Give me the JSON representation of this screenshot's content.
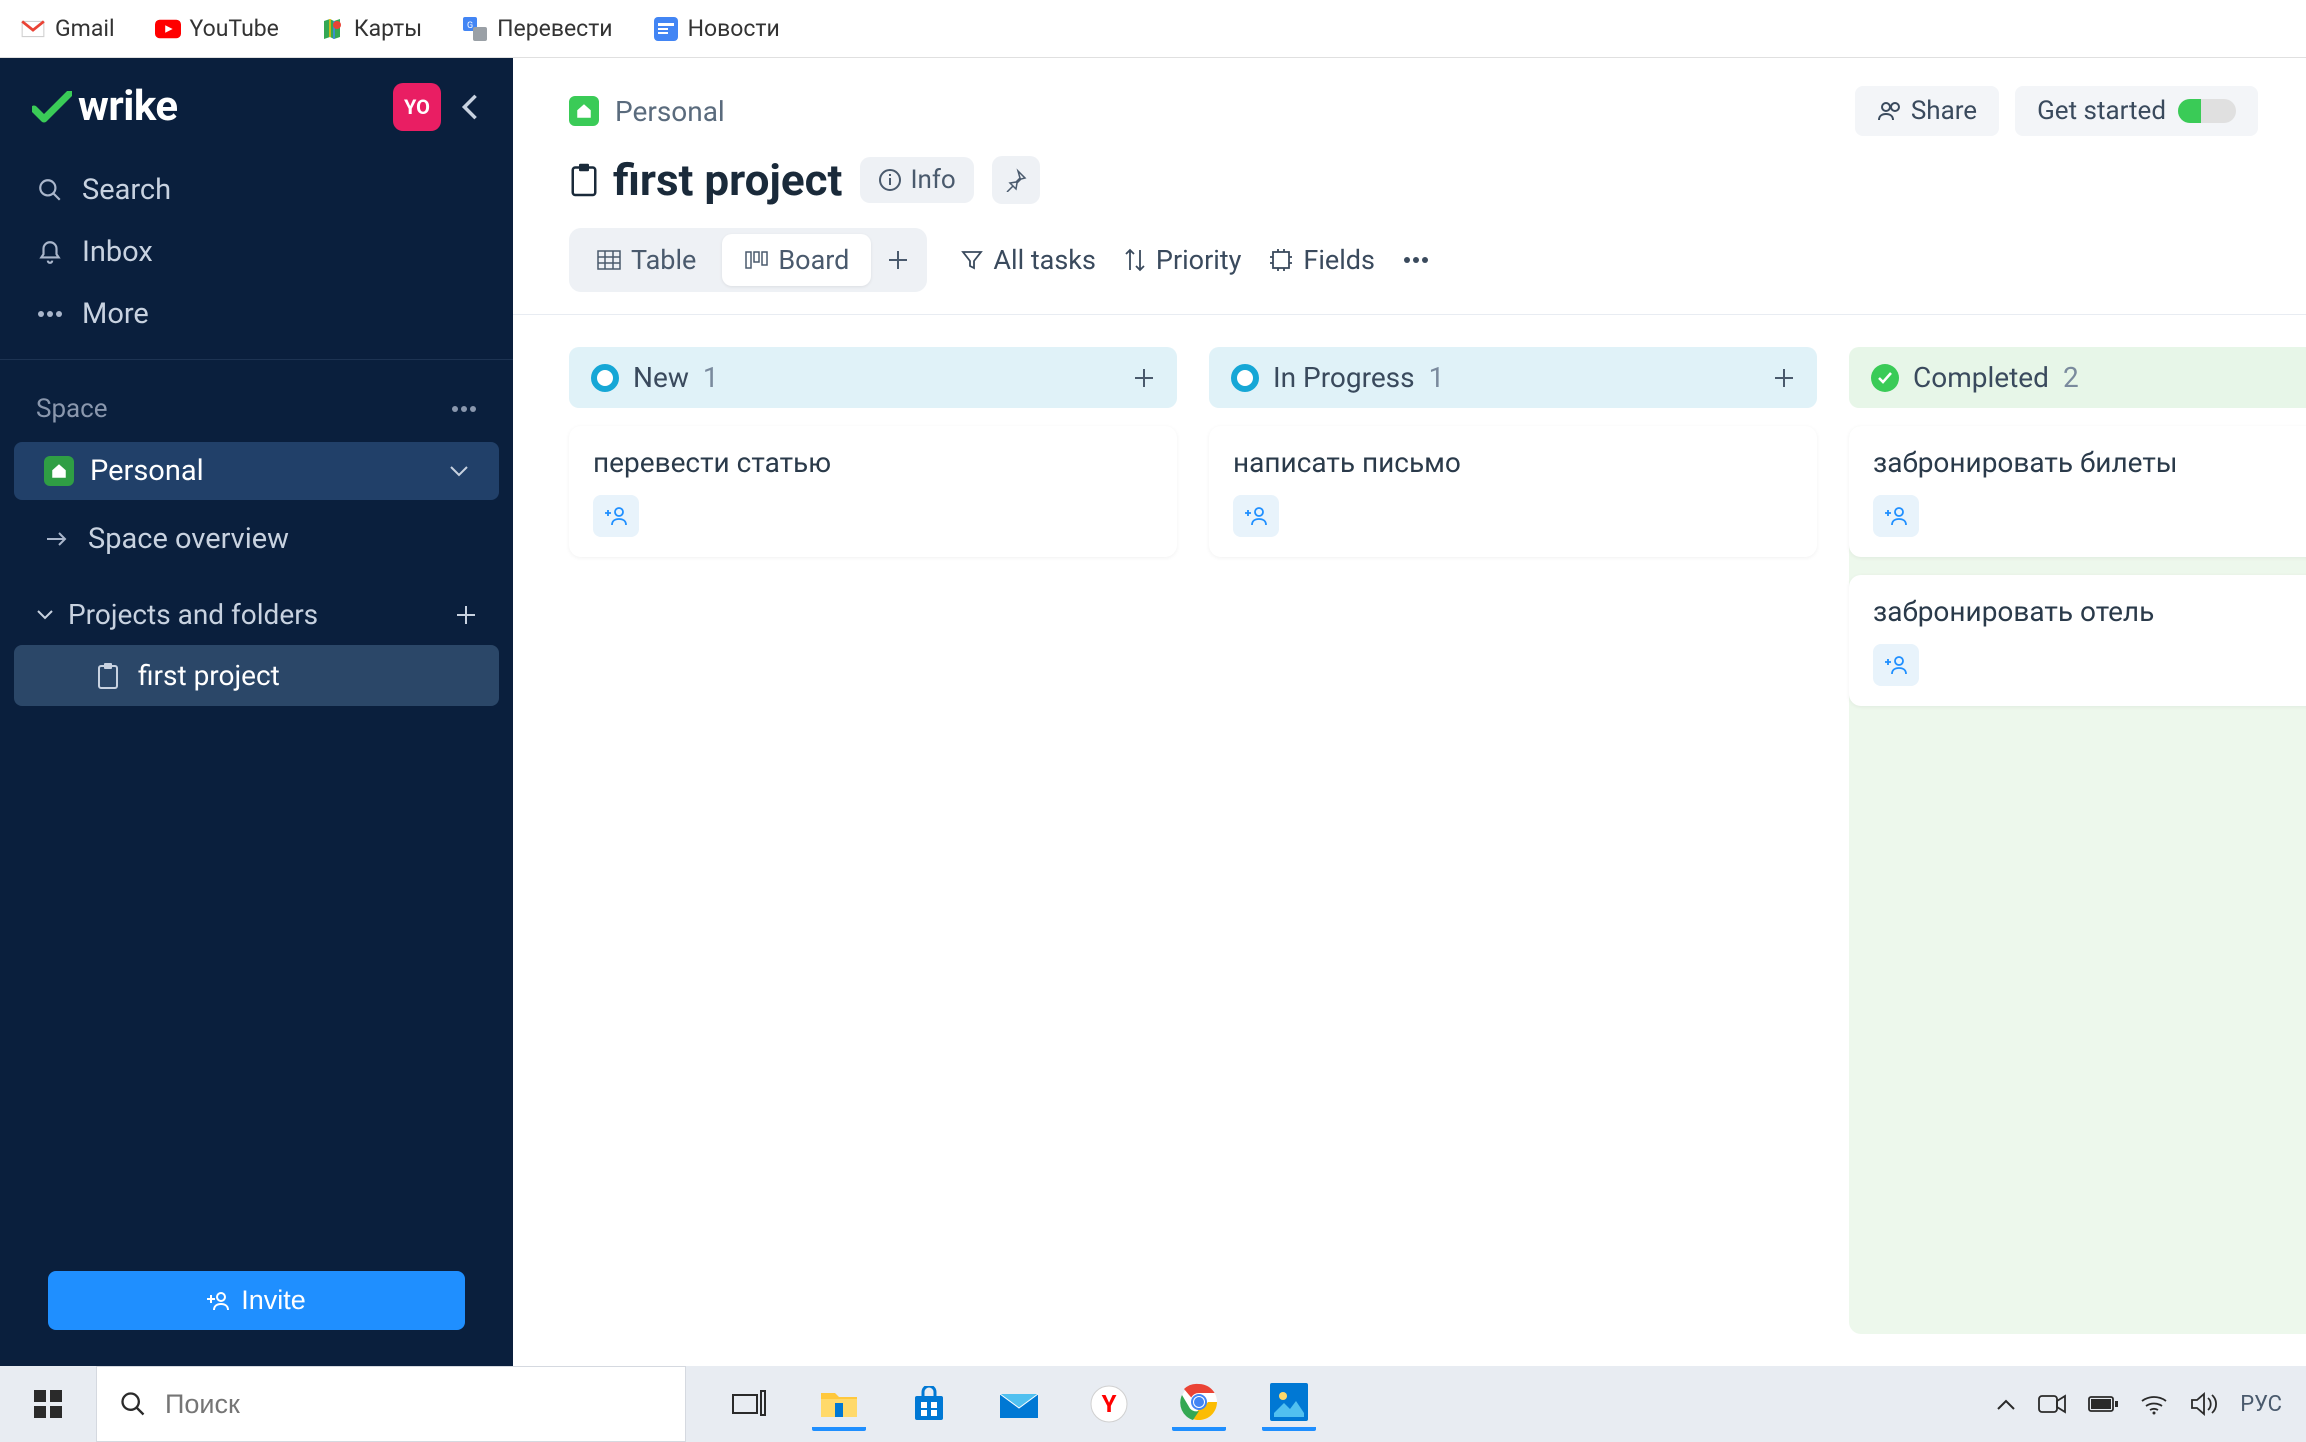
{
  "bookmarks": [
    {
      "label": "Gmail"
    },
    {
      "label": "YouTube"
    },
    {
      "label": "Карты"
    },
    {
      "label": "Перевести"
    },
    {
      "label": "Новости"
    }
  ],
  "sidebar": {
    "logo": "wrike",
    "avatar": "YO",
    "nav": {
      "search": "Search",
      "inbox": "Inbox",
      "more": "More"
    },
    "space_label": "Space",
    "space_name": "Personal",
    "overview": "Space overview",
    "projects_label": "Projects and folders",
    "project1": "first project",
    "invite": "Invite"
  },
  "header": {
    "breadcrumb": "Personal",
    "share": "Share",
    "get_started": "Get started"
  },
  "title": {
    "text": "first project",
    "info": "Info"
  },
  "toolbar": {
    "table": "Table",
    "board": "Board",
    "alltasks": "All tasks",
    "priority": "Priority",
    "fields": "Fields"
  },
  "board": {
    "columns": [
      {
        "name": "New",
        "count": "1",
        "status": "new",
        "cards": [
          {
            "title": "перевести статью"
          }
        ]
      },
      {
        "name": "In Progress",
        "count": "1",
        "status": "progress",
        "cards": [
          {
            "title": "написать письмо"
          }
        ]
      },
      {
        "name": "Completed",
        "count": "2",
        "status": "done",
        "cards": [
          {
            "title": "забронировать билеты"
          },
          {
            "title": "забронировать отель"
          }
        ]
      }
    ]
  },
  "taskbar": {
    "search_placeholder": "Поиск",
    "lang": "РУС"
  }
}
